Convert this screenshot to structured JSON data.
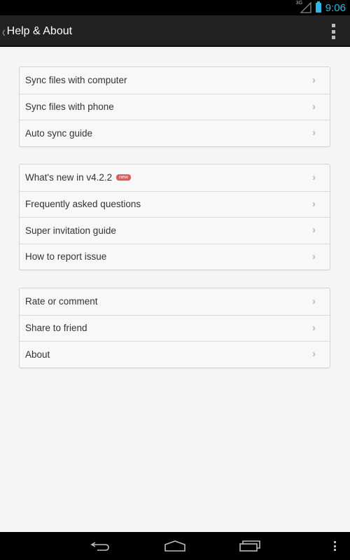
{
  "status_bar": {
    "network": "3G",
    "time": "9:06",
    "accent_color": "#33b5e5"
  },
  "action_bar": {
    "title": "Help & About",
    "back_icon": "chevron-left-icon",
    "overflow_icon": "overflow-menu-icon"
  },
  "groups": [
    {
      "items": [
        {
          "label": "Sync files with computer"
        },
        {
          "label": "Sync files with phone"
        },
        {
          "label": "Auto sync guide"
        }
      ]
    },
    {
      "items": [
        {
          "label": "What's new in v4.2.2",
          "badge": "new"
        },
        {
          "label": "Frequently asked questions"
        },
        {
          "label": "Super invitation guide"
        },
        {
          "label": "How to report issue"
        }
      ]
    },
    {
      "items": [
        {
          "label": "Rate or comment"
        },
        {
          "label": "Share to friend"
        },
        {
          "label": "About"
        }
      ]
    }
  ],
  "chevron_glyph": "›",
  "badge_color": "#e05a5a",
  "nav_bar": {
    "back": "back-icon",
    "home": "home-icon",
    "recents": "recents-icon",
    "menu": "overflow-menu-icon"
  }
}
